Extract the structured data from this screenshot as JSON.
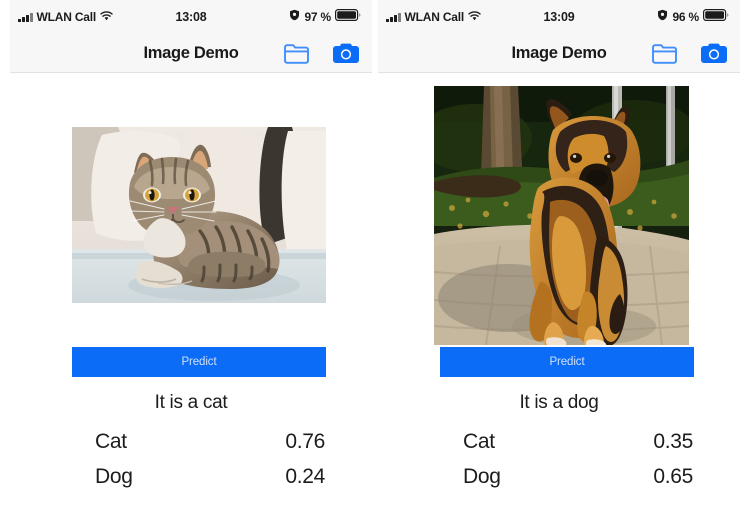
{
  "panels": [
    {
      "status": {
        "carrier": "WLAN Call",
        "wifi_icon": "wifi-icon",
        "signal_icon": "signal-bars-icon",
        "time": "13:08",
        "alarm_icon": "shield-icon",
        "battery_percent": "97 %",
        "battery_icon": "battery-full-icon"
      },
      "nav": {
        "title": "Image Demo",
        "folder_icon": "folder-icon",
        "camera_icon": "camera-icon"
      },
      "photo": {
        "name": "cat-photo",
        "alt": "Tabby cat lying on a light sofa with cushions"
      },
      "predict_label": "Predict",
      "verdict": "It is a cat",
      "scores": [
        {
          "label": "Cat",
          "value": "0.76"
        },
        {
          "label": "Dog",
          "value": "0.24"
        }
      ]
    },
    {
      "status": {
        "carrier": "WLAN Call",
        "wifi_icon": "wifi-icon",
        "signal_icon": "signal-bars-icon",
        "time": "13:09",
        "alarm_icon": "shield-icon",
        "battery_percent": "96 %",
        "battery_icon": "battery-full-icon"
      },
      "nav": {
        "title": "Image Demo",
        "folder_icon": "folder-icon",
        "camera_icon": "camera-icon"
      },
      "photo": {
        "name": "dog-photo",
        "alt": "German shepherd dog walking on a path in a park"
      },
      "predict_label": "Predict",
      "verdict": "It is a dog",
      "scores": [
        {
          "label": "Cat",
          "value": "0.35"
        },
        {
          "label": "Dog",
          "value": "0.65"
        }
      ]
    }
  ],
  "colors": {
    "accent": "#0b6cf7",
    "statusbar_bg": "#f7f7f7",
    "page_bg": "#ffffff",
    "text": "#1c1c1c"
  }
}
